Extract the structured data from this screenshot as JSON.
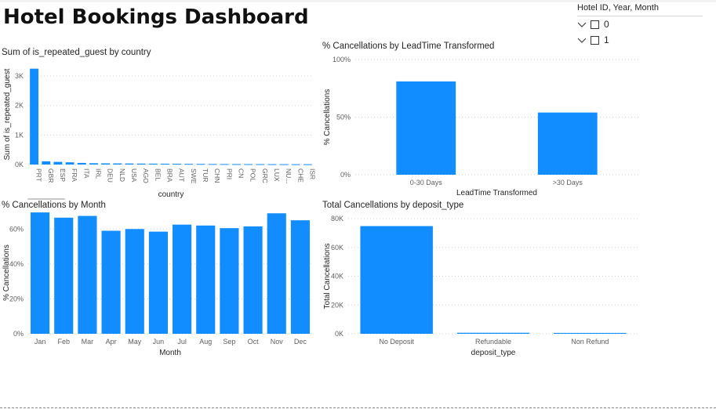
{
  "dashboard": {
    "title": "Hotel Bookings Dashboard"
  },
  "slicer": {
    "header": "Hotel ID, Year, Month",
    "items": [
      {
        "label": "0"
      },
      {
        "label": "1"
      }
    ]
  },
  "colors": {
    "bar": "#118DFF",
    "grid": "#cfcfcf",
    "axis_text": "#605e5c",
    "title_text": "#252423"
  },
  "chart_data": [
    {
      "id": "country",
      "type": "bar",
      "title": "Sum of is_repeated_guest by country",
      "xlabel": "country",
      "ylabel": "Sum of is_repeated_guest",
      "categories": [
        "PRT",
        "GBR",
        "ESP",
        "FRA",
        "ITA",
        "IRL",
        "DEU",
        "NLD",
        "USA",
        "AGO",
        "BEL",
        "BRA",
        "AUT",
        "SWE",
        "TUR",
        "CHN",
        "PRI",
        "CN",
        "POL",
        "GRC",
        "LUX",
        "NU...",
        "CHE",
        "ISR"
      ],
      "values": [
        3250,
        110,
        90,
        75,
        55,
        45,
        40,
        38,
        35,
        32,
        30,
        28,
        25,
        23,
        20,
        18,
        16,
        15,
        14,
        13,
        12,
        11,
        10,
        10
      ],
      "ylim": [
        0,
        3400
      ],
      "yticks": [
        0,
        1000,
        2000,
        3000
      ],
      "ytick_labels": [
        "0K",
        "1K",
        "2K",
        "3K"
      ]
    },
    {
      "id": "leadtime",
      "type": "bar",
      "title": "% Cancellations by LeadTime Transformed",
      "xlabel": "LeadTime Transformed",
      "ylabel": "% Cancellations",
      "categories": [
        "0-30 Days",
        ">30 Days"
      ],
      "values": [
        81,
        54
      ],
      "ylim": [
        0,
        100
      ],
      "yticks": [
        0,
        50,
        100
      ],
      "ytick_labels": [
        "0%",
        "50%",
        "100%"
      ]
    },
    {
      "id": "month",
      "type": "bar",
      "title": "% Cancellations by Month",
      "xlabel": "Month",
      "ylabel": "% Cancellations",
      "categories": [
        "Jan",
        "Feb",
        "Mar",
        "Apr",
        "May",
        "Jun",
        "Jul",
        "Aug",
        "Sep",
        "Oct",
        "Nov",
        "Dec"
      ],
      "values": [
        69.5,
        66.5,
        67.5,
        59,
        60,
        58.5,
        62.5,
        62,
        60.5,
        61.5,
        69,
        65
      ],
      "ylim": [
        0,
        70
      ],
      "yticks": [
        0,
        20,
        40,
        60
      ],
      "ytick_labels": [
        "0%",
        "20%",
        "40%",
        "60%"
      ]
    },
    {
      "id": "deposit",
      "type": "bar",
      "title": "Total Cancellations by deposit_type",
      "xlabel": "deposit_type",
      "ylabel": "Total Cancellations",
      "categories": [
        "No Deposit",
        "Refundable",
        "Non Refund"
      ],
      "values": [
        74800,
        700,
        600
      ],
      "ylim": [
        0,
        80000
      ],
      "yticks": [
        0,
        20000,
        40000,
        60000,
        80000
      ],
      "ytick_labels": [
        "0K",
        "20K",
        "40K",
        "60K",
        "80K"
      ]
    }
  ]
}
